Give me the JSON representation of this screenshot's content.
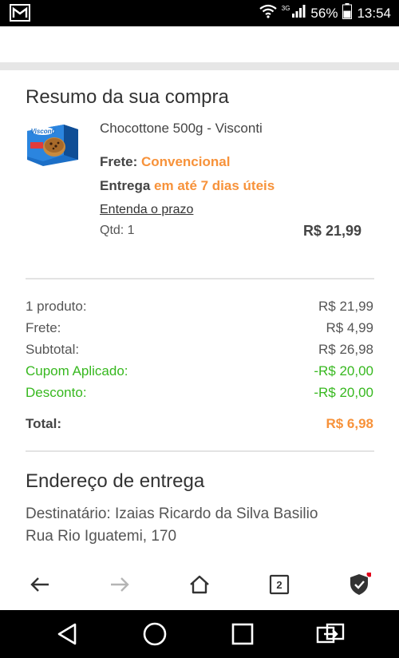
{
  "status_bar": {
    "network": "3G",
    "battery": "56%",
    "time": "13:54"
  },
  "summary": {
    "title": "Resumo da sua compra",
    "product_name": "Chocottone 500g - Visconti",
    "frete_label": "Frete:",
    "frete_value": "Convencional",
    "entrega_label": "Entrega",
    "entrega_value": "em até 7 dias úteis",
    "prazo_link": "Entenda o prazo",
    "qtd": "Qtd: 1",
    "item_price": "R$ 21,99"
  },
  "totals": [
    {
      "label": "1 produto:",
      "value": "R$ 21,99"
    },
    {
      "label": "Frete:",
      "value": "R$ 4,99"
    },
    {
      "label": "Subtotal:",
      "value": "R$ 26,98"
    },
    {
      "label": "Cupom Aplicado:",
      "value": "-R$ 20,00"
    },
    {
      "label": "Desconto:",
      "value": "-R$ 20,00"
    }
  ],
  "total": {
    "label": "Total:",
    "value": "R$ 6,98"
  },
  "address": {
    "title": "Endereço de entrega",
    "recipient": "Destinatário: Izaias Ricardo da Silva Basilio",
    "street": "Rua Rio Iguatemi, 170"
  },
  "browser": {
    "tab_count": "2"
  },
  "colors": {
    "accent_orange": "#f7923a",
    "discount_green": "#37b81f"
  }
}
